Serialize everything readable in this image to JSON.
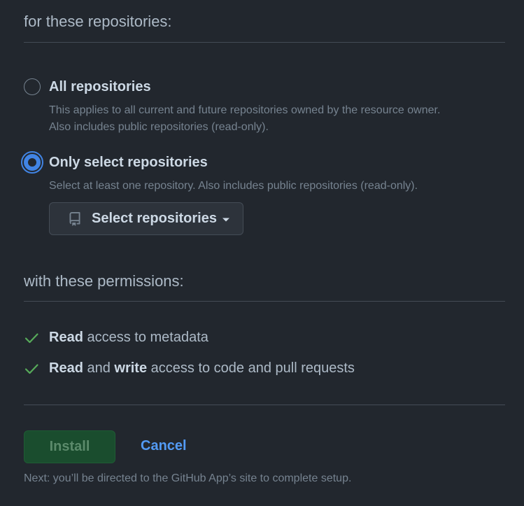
{
  "repositories_section": {
    "title": "for these repositories:",
    "options": [
      {
        "label": "All repositories",
        "checked": false,
        "description_line1": "This applies to all current and future repositories owned by the resource owner.",
        "description_line2": "Also includes public repositories (read-only)."
      },
      {
        "label": "Only select repositories",
        "checked": true,
        "description_line1": "Select at least one repository. Also includes public repositories (read-only)."
      }
    ],
    "select_button_label": "Select repositories",
    "select_button_icon": "repo-icon"
  },
  "permissions_section": {
    "title": "with these permissions:",
    "items": [
      {
        "bold1": "Read",
        "text": " access to metadata"
      },
      {
        "bold1": "Read",
        "mid": " and ",
        "bold2": "write",
        "text": " access to code and pull requests"
      }
    ]
  },
  "actions": {
    "install_label": "Install",
    "cancel_label": "Cancel",
    "next_note": "Next: you’ll be directed to the GitHub App’s site to complete setup."
  },
  "colors": {
    "background": "#22272e",
    "accent_blue": "#539bf5",
    "radio_blue": "#4184e4",
    "check_green": "#57ab5a",
    "install_bg": "#1a4d2e"
  }
}
